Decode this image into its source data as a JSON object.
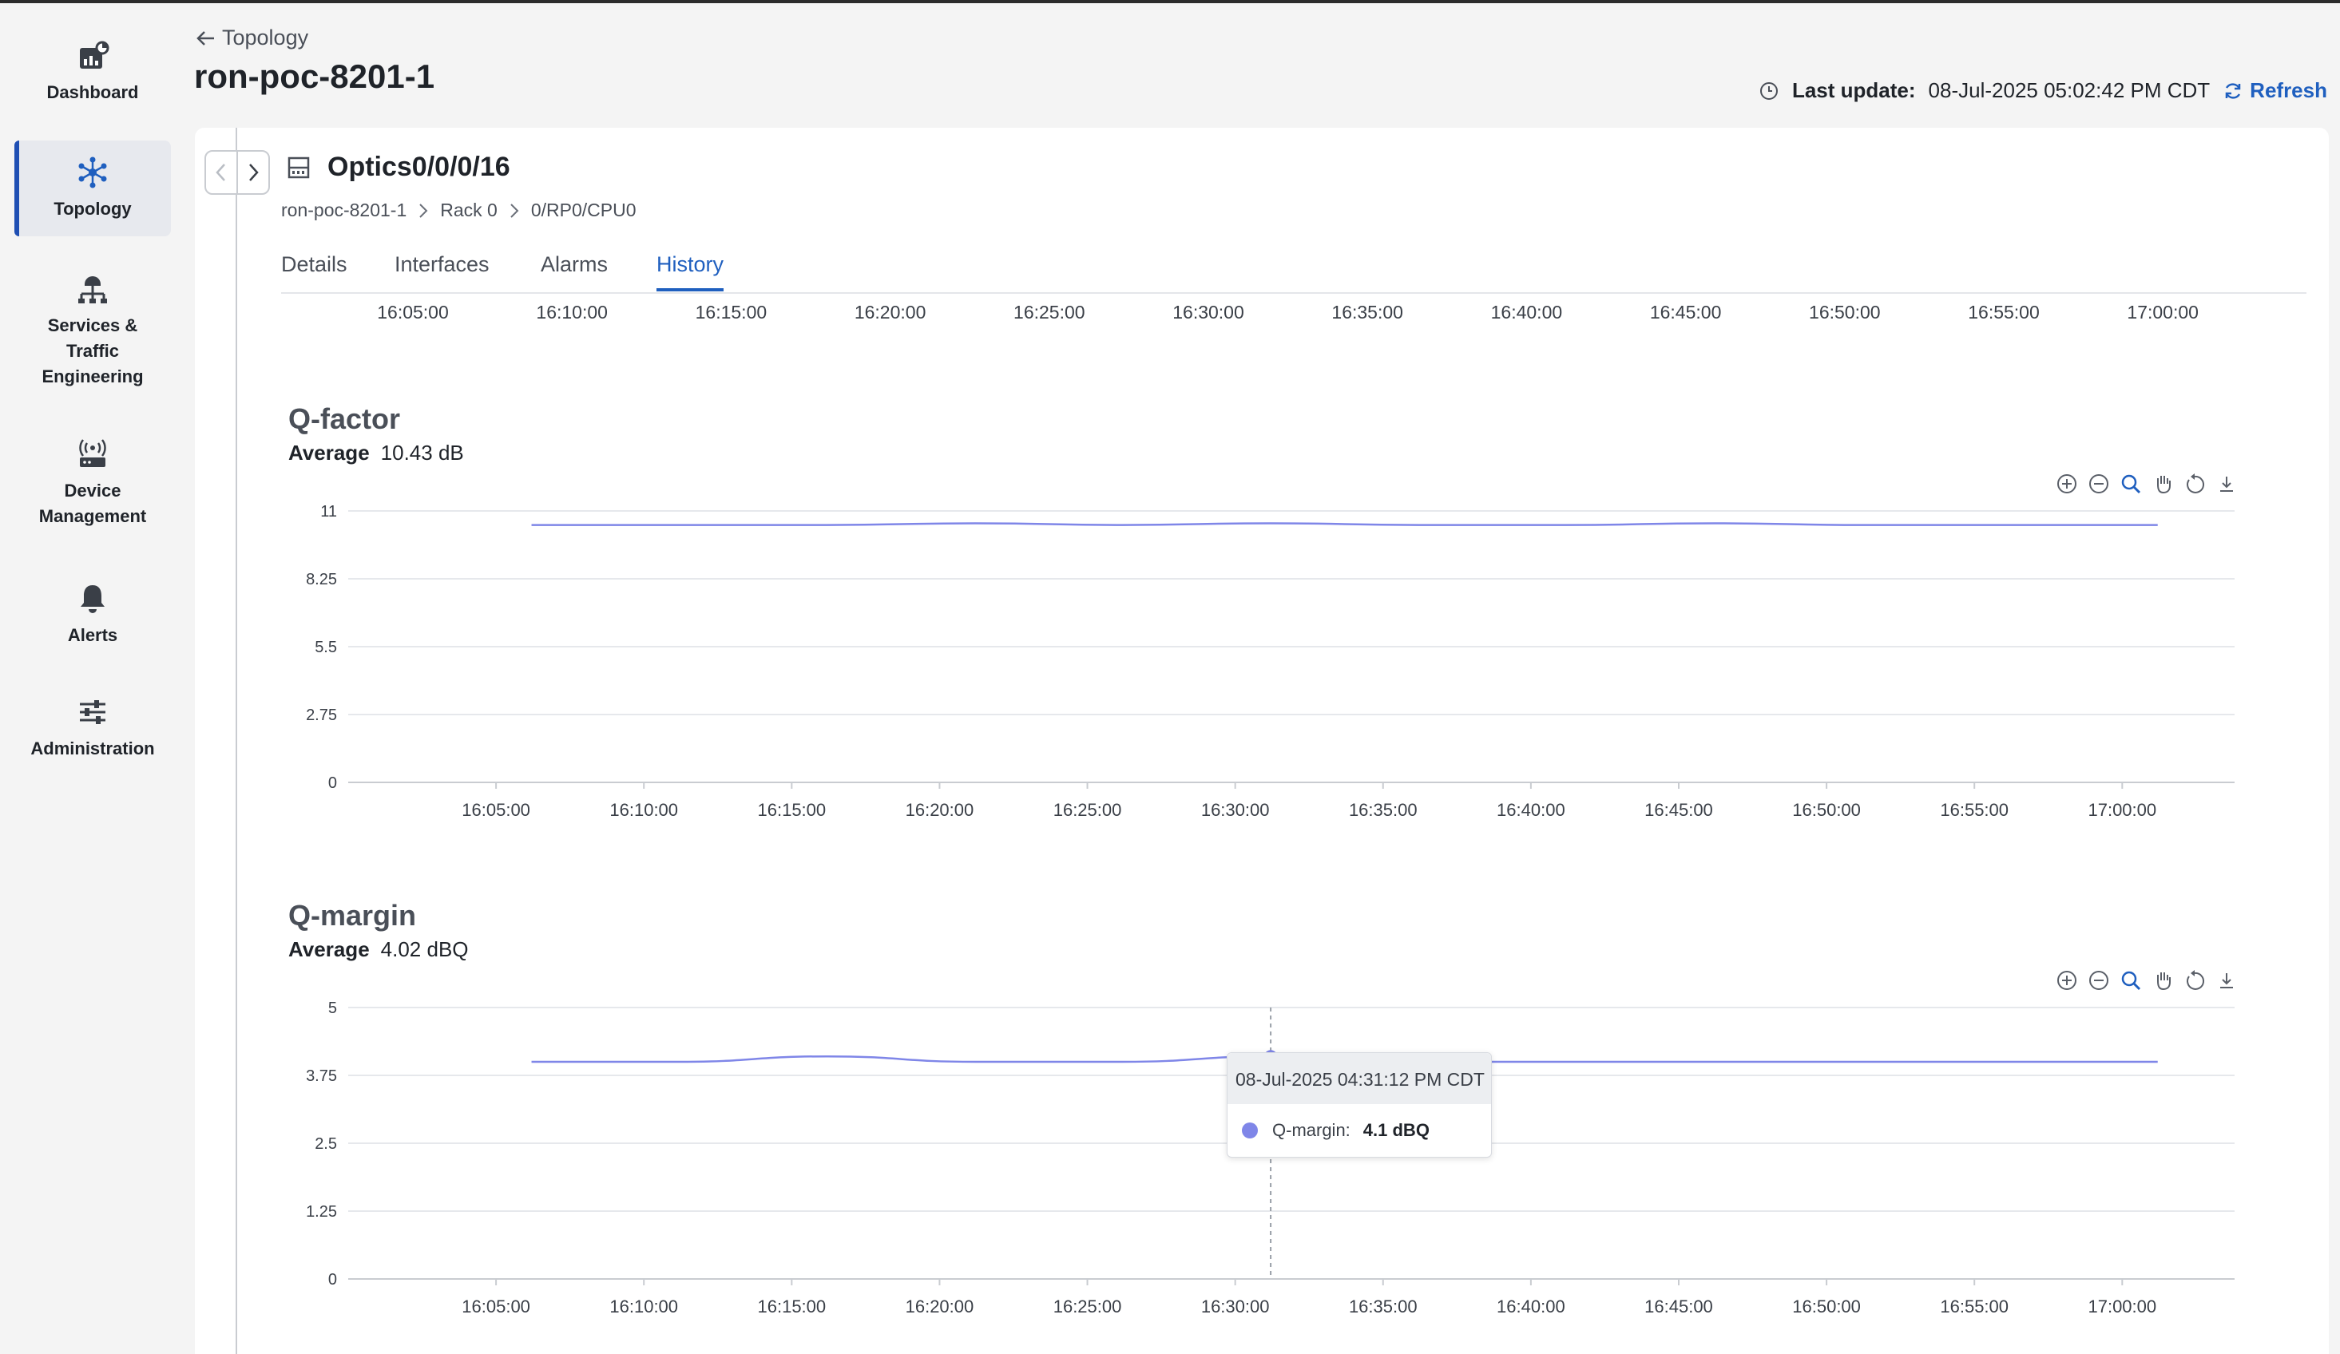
{
  "nav": {
    "items": [
      {
        "label": "Dashboard",
        "icon": "dashboard-icon",
        "active": false
      },
      {
        "label": "Topology",
        "icon": "topology-icon",
        "active": true
      },
      {
        "label": "Services & Traffic Engineering",
        "lines": [
          "Services &",
          "Traffic",
          "Engineering"
        ],
        "icon": "services-icon",
        "active": false
      },
      {
        "label": "Device Management",
        "lines": [
          "Device",
          "Management"
        ],
        "icon": "device-management-icon",
        "active": false
      },
      {
        "label": "Alerts",
        "icon": "bell-icon",
        "active": false
      },
      {
        "label": "Administration",
        "icon": "sliders-icon",
        "active": false
      }
    ]
  },
  "header": {
    "back_label": "Topology",
    "title": "ron-poc-8201-1",
    "last_update_label": "Last update:",
    "last_update_value": "08-Jul-2025 05:02:42 PM CDT",
    "refresh_label": "Refresh"
  },
  "panel": {
    "title": "Optics0/0/0/16",
    "breadcrumb": [
      "ron-poc-8201-1",
      "Rack 0",
      "0/RP0/CPU0"
    ],
    "tabs": [
      "Details",
      "Interfaces",
      "Alarms",
      "History"
    ],
    "active_tab": "History",
    "top_axis_ticks": [
      "16:05:00",
      "16:10:00",
      "16:15:00",
      "16:20:00",
      "16:25:00",
      "16:30:00",
      "16:35:00",
      "16:40:00",
      "16:45:00",
      "16:50:00",
      "16:55:00",
      "17:00:00"
    ]
  },
  "colors": {
    "accent": "#1f5fbf",
    "series": "#7f86e8"
  },
  "chart_data": [
    {
      "type": "line",
      "title": "Q-factor",
      "average_label": "Average",
      "average_value": "10.43 dB",
      "ylim": [
        0,
        11
      ],
      "y_ticks": [
        "0",
        "2.75",
        "5.5",
        "8.25",
        "11"
      ],
      "x_ticks": [
        "16:05:00",
        "16:10:00",
        "16:15:00",
        "16:20:00",
        "16:25:00",
        "16:30:00",
        "16:35:00",
        "16:40:00",
        "16:45:00",
        "16:50:00",
        "16:55:00",
        "17:00:00"
      ],
      "x_minutes": [
        6.2,
        11.2,
        16.2,
        21.2,
        26.2,
        31.2,
        36.2,
        41.2,
        46.2,
        51.2,
        56.2,
        61.2
      ],
      "values": [
        10.43,
        10.43,
        10.43,
        10.5,
        10.43,
        10.5,
        10.43,
        10.43,
        10.5,
        10.43,
        10.43,
        10.43
      ],
      "grid": true
    },
    {
      "type": "line",
      "title": "Q-margin",
      "average_label": "Average",
      "average_value": "4.02 dBQ",
      "ylim": [
        0,
        5
      ],
      "y_ticks": [
        "0",
        "1.25",
        "2.5",
        "3.75",
        "5"
      ],
      "x_ticks": [
        "16:05:00",
        "16:10:00",
        "16:15:00",
        "16:20:00",
        "16:25:00",
        "16:30:00",
        "16:35:00",
        "16:40:00",
        "16:45:00",
        "16:50:00",
        "16:55:00",
        "17:00:00"
      ],
      "x_minutes": [
        6.2,
        11.2,
        16.2,
        21.2,
        26.2,
        31.2,
        36.2,
        41.2,
        46.2,
        51.2,
        56.2,
        61.2
      ],
      "values": [
        4.0,
        4.0,
        4.1,
        4.0,
        4.0,
        4.1,
        4.0,
        4.0,
        4.0,
        4.0,
        4.0,
        4.0
      ],
      "grid": true,
      "tooltip": {
        "time": "08-Jul-2025 04:31:12 PM CDT",
        "series_name": "Q-margin:",
        "value": "4.1 dBQ",
        "x_minute": 31.2,
        "y": 4.1
      }
    }
  ]
}
